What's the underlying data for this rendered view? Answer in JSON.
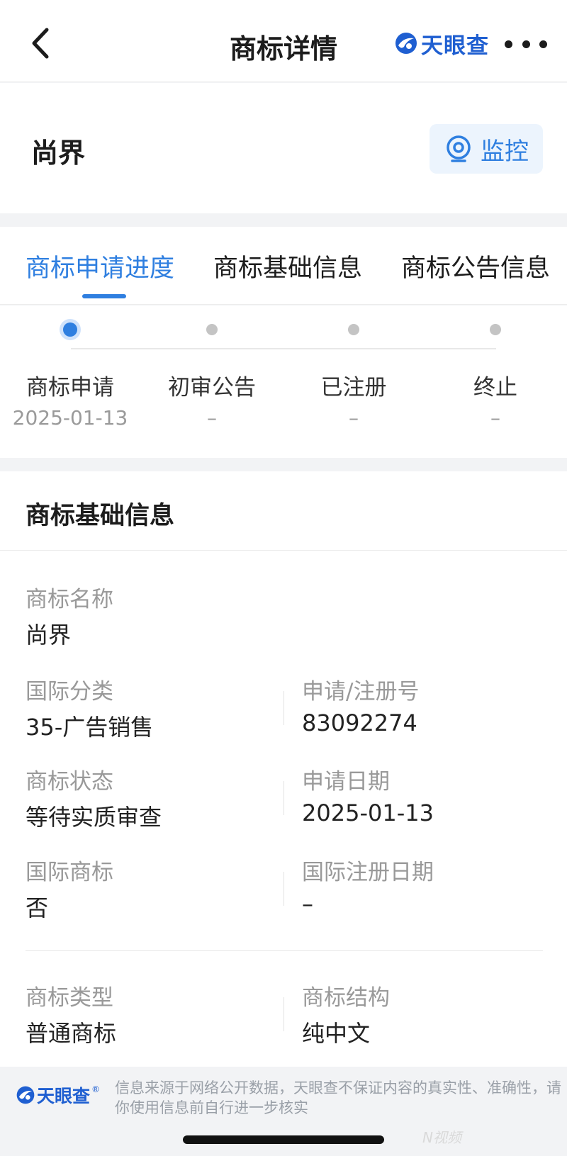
{
  "nav": {
    "title": "商标详情",
    "brand": "天眼查"
  },
  "header": {
    "trademark_name": "尚界",
    "monitor_label": "监控"
  },
  "tabs": [
    {
      "label": "商标申请进度",
      "active": true
    },
    {
      "label": "商标基础信息",
      "active": false
    },
    {
      "label": "商标公告信息",
      "active": false
    }
  ],
  "progress": [
    {
      "label": "商标申请",
      "date": "2025-01-13",
      "active": true
    },
    {
      "label": "初审公告",
      "date": "–",
      "active": false
    },
    {
      "label": "已注册",
      "date": "–",
      "active": false
    },
    {
      "label": "终止",
      "date": "–",
      "active": false
    }
  ],
  "basic_info": {
    "title": "商标基础信息",
    "name_label": "商标名称",
    "name_value": "尚界",
    "intl_class_label": "国际分类",
    "intl_class_value": "35-广告销售",
    "reg_no_label": "申请/注册号",
    "reg_no_value": "83092274",
    "status_label": "商标状态",
    "status_value": "等待实质审查",
    "apply_date_label": "申请日期",
    "apply_date_value": "2025-01-13",
    "intl_tm_label": "国际商标",
    "intl_tm_value": "否",
    "intl_reg_date_label": "国际注册日期",
    "intl_reg_date_value": "–",
    "type_label": "商标类型",
    "type_value": "普通商标",
    "structure_label": "商标结构",
    "structure_value": "纯中文"
  },
  "footer": {
    "brand": "天眼查",
    "registered_mark": "®",
    "disclaimer": "信息来源于网络公开数据，天眼查不保证内容的真实性、准确性，请你使用信息前自行进一步核实",
    "watermark": "N视频"
  },
  "colors": {
    "accent": "#2f7fe0",
    "brand": "#1f5fd1",
    "page_bg": "#f2f3f5"
  },
  "icons": {
    "back": "chevron-left-icon",
    "brand_logo": "tianyancha-logo-icon",
    "more": "more-dots-icon",
    "monitor": "camera-monitor-icon"
  }
}
